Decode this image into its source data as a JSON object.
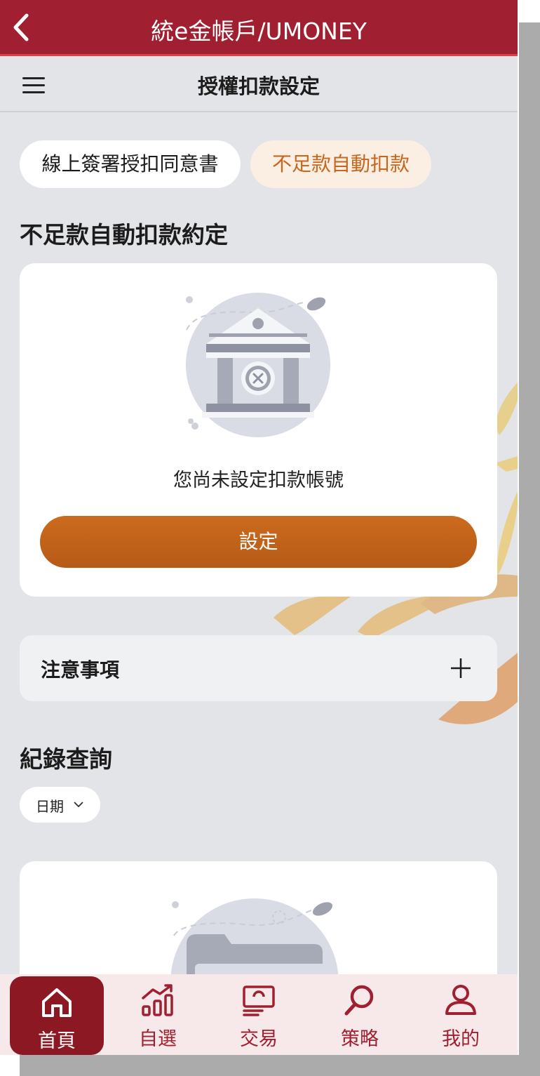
{
  "app_bar": {
    "title": "統e金帳戶/UMONEY"
  },
  "sub_bar": {
    "title": "授權扣款設定"
  },
  "tabs": [
    {
      "label": "線上簽署授扣同意書",
      "active": false
    },
    {
      "label": "不足款自動扣款",
      "active": true
    }
  ],
  "agreement": {
    "title": "不足款自動扣款約定",
    "empty_message": "您尚未設定扣款帳號",
    "set_button": "設定"
  },
  "notice": {
    "label": "注意事項"
  },
  "records": {
    "title": "紀錄查詢",
    "date_filter": "日期"
  },
  "bottom_nav": [
    {
      "label": "首頁",
      "icon": "home-icon",
      "active": true
    },
    {
      "label": "自選",
      "icon": "chart-icon",
      "active": false
    },
    {
      "label": "交易",
      "icon": "money-icon",
      "active": false
    },
    {
      "label": "策略",
      "icon": "search-icon",
      "active": false
    },
    {
      "label": "我的",
      "icon": "user-icon",
      "active": false
    }
  ],
  "colors": {
    "brand": "#a01f30",
    "accent": "#c8661e",
    "background": "#e3e4e8"
  }
}
